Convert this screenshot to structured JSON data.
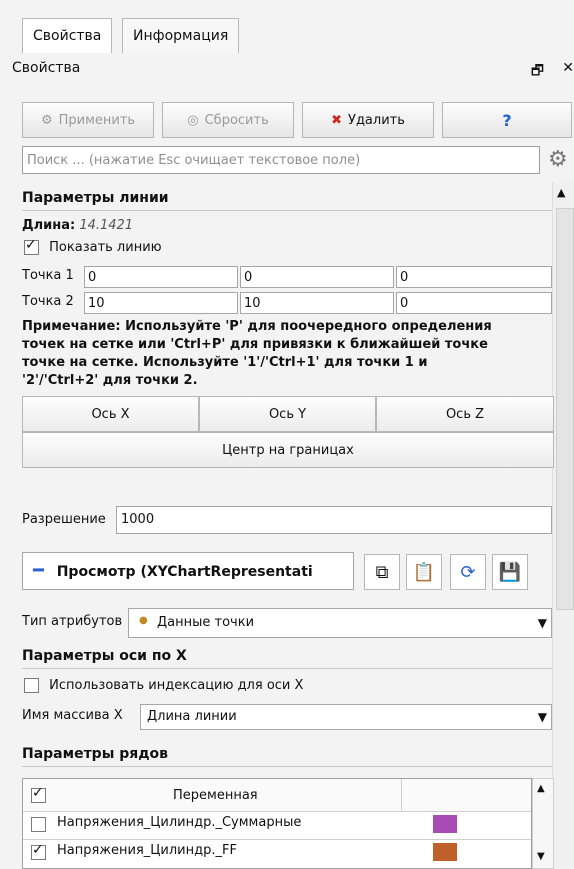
{
  "tabs": [
    {
      "label": "Свойства",
      "active": true
    },
    {
      "label": "Информация",
      "active": false
    }
  ],
  "panel": {
    "title": "Свойства",
    "float_icon": "float-icon",
    "close_icon": "close-icon"
  },
  "toolbar": {
    "apply_label": "Применить",
    "reset_label": "Сбросить",
    "delete_label": "Удалить",
    "help_label": "?"
  },
  "search": {
    "placeholder": "Поиск ... (нажатие Esc очищает текстовое поле)"
  },
  "line_params": {
    "title": "Параметры линии",
    "length_label": "Длина:",
    "length_value": "14.1421",
    "show_line_label": "Показать линию",
    "show_line_checked": true,
    "point1_label": "Точка 1",
    "point1_values": [
      "0",
      "0",
      "0"
    ],
    "point2_label": "Точка 2",
    "point2_values": [
      "10",
      "10",
      "0"
    ],
    "note_line1": "Примечание: Используйте 'P' для поочередного определения",
    "note_line2": "точек на сетке или 'Ctrl+P' для привязки к ближайшей точке",
    "note_line3": "точке на сетке. Используйте '1'/'Ctrl+1' для точки 1 и",
    "note_line4": "'2'/'Ctrl+2' для точки 2.",
    "axis_x": "Ось X",
    "axis_y": "Ось Y",
    "axis_z": "Ось Z",
    "center_on_bounds": "Центр на границах"
  },
  "resolution": {
    "label": "Разрешение",
    "value": "1000"
  },
  "view": {
    "label": "Просмотр (XYChartRepresentati"
  },
  "attr_type": {
    "label": "Тип атрибутов",
    "value": "Данные точки"
  },
  "x_axis_params": {
    "title": "Параметры оси по X",
    "use_index_label": "Использовать индексацию для оси X",
    "use_index_checked": false,
    "array_label": "Имя массива X",
    "array_value": "Длина линии"
  },
  "series_params": {
    "title": "Параметры рядов",
    "header_variable": "Переменная",
    "rows": [
      {
        "name": "Напряжения_Цилиндр._Суммарные",
        "checked": false,
        "color": "#a84bb4"
      },
      {
        "name": "Напряжения_Цилиндр._FF",
        "checked": true,
        "color": "#c0602a"
      }
    ]
  },
  "colors": {
    "delete_icon": "#cc2b1f",
    "help_icon": "#1f5fcf",
    "view_minus": "#2b62d0"
  }
}
